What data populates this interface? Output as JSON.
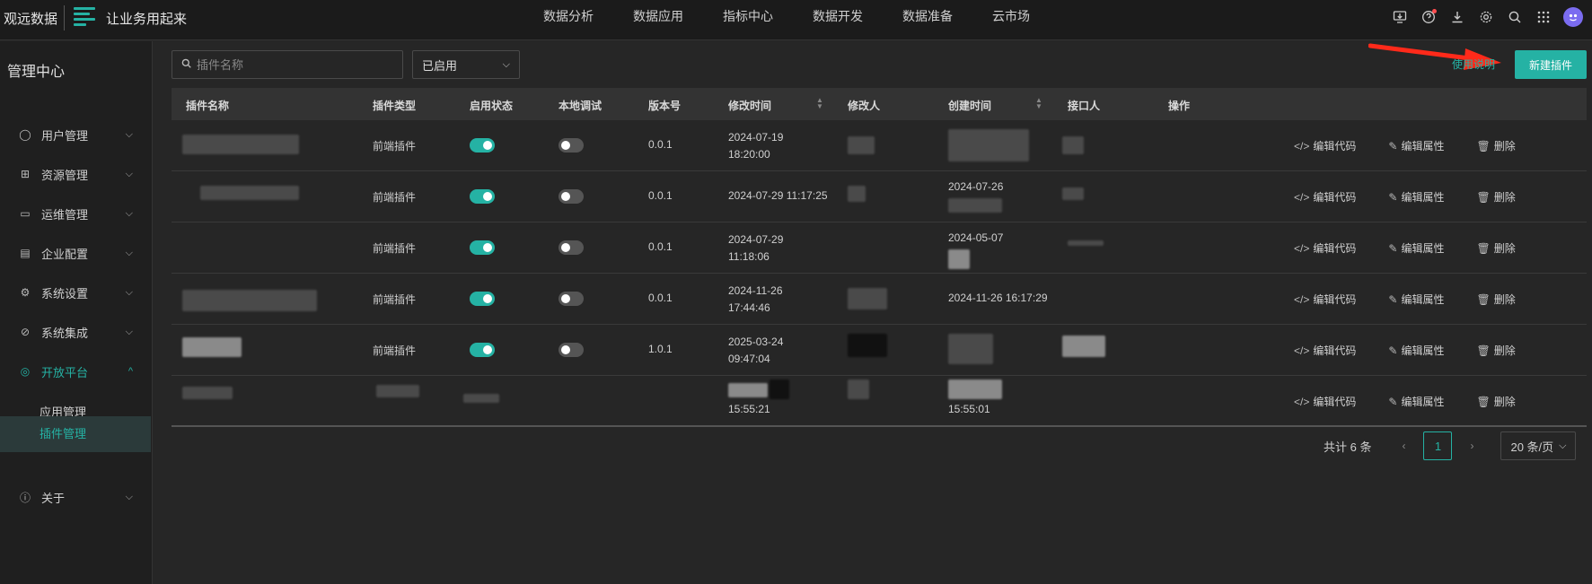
{
  "header": {
    "brand": "观远数据",
    "slogan": "让业务用起来",
    "nav": [
      "数据分析",
      "数据应用",
      "指标中心",
      "数据开发",
      "数据准备",
      "云市场"
    ]
  },
  "sidebar": {
    "title": "管理中心",
    "items": [
      {
        "label": "用户管理",
        "icon": "user-icon"
      },
      {
        "label": "资源管理",
        "icon": "grid-icon"
      },
      {
        "label": "运维管理",
        "icon": "monitor-icon"
      },
      {
        "label": "企业配置",
        "icon": "building-icon"
      },
      {
        "label": "系统设置",
        "icon": "settings-icon"
      },
      {
        "label": "系统集成",
        "icon": "integration-icon"
      },
      {
        "label": "开放平台",
        "icon": "platform-icon"
      }
    ],
    "subitems": [
      "应用管理",
      "插件管理"
    ],
    "about": "关于"
  },
  "toolbar": {
    "search_placeholder": "插件名称",
    "status_filter": "已启用",
    "help_link": "使用说明",
    "new_button": "新建插件"
  },
  "table": {
    "columns": [
      "插件名称",
      "插件类型",
      "启用状态",
      "本地调试",
      "版本号",
      "修改时间",
      "修改人",
      "创建时间",
      "接口人",
      "操作"
    ],
    "rows": [
      {
        "type": "前端插件",
        "enabled": true,
        "debug": false,
        "version": "0.0.1",
        "modified_date": "2024-07-19",
        "modified_time": "18:20:00",
        "created_line1": "",
        "created_line2": ""
      },
      {
        "type": "前端插件",
        "enabled": true,
        "debug": false,
        "version": "0.0.1",
        "modified_date": "2024-07-29 11:17:25",
        "modified_time": "",
        "created_line1": "2024-07-26",
        "created_line2": ""
      },
      {
        "type": "前端插件",
        "enabled": true,
        "debug": false,
        "version": "0.0.1",
        "modified_date": "2024-07-29",
        "modified_time": "11:18:06",
        "created_line1": "2024-05-07",
        "created_line2": ""
      },
      {
        "type": "前端插件",
        "enabled": true,
        "debug": false,
        "version": "0.0.1",
        "modified_date": "2024-11-26",
        "modified_time": "17:44:46",
        "created_line1": "2024-11-26 16:17:29",
        "created_line2": ""
      },
      {
        "type": "前端插件",
        "enabled": true,
        "debug": false,
        "version": "1.0.1",
        "modified_date": "2025-03-24",
        "modified_time": "09:47:04",
        "created_line1": "",
        "created_line2": ""
      },
      {
        "type": "",
        "enabled": null,
        "debug": null,
        "version": "",
        "modified_date": "",
        "modified_time": "15:55:21",
        "created_line1": "",
        "created_line2": "15:55:01"
      }
    ],
    "actions": {
      "edit_code": "编辑代码",
      "edit_props": "编辑属性",
      "delete": "删除"
    }
  },
  "pagination": {
    "total": "共计 6 条",
    "current_page": "1",
    "page_size": "20 条/页"
  }
}
